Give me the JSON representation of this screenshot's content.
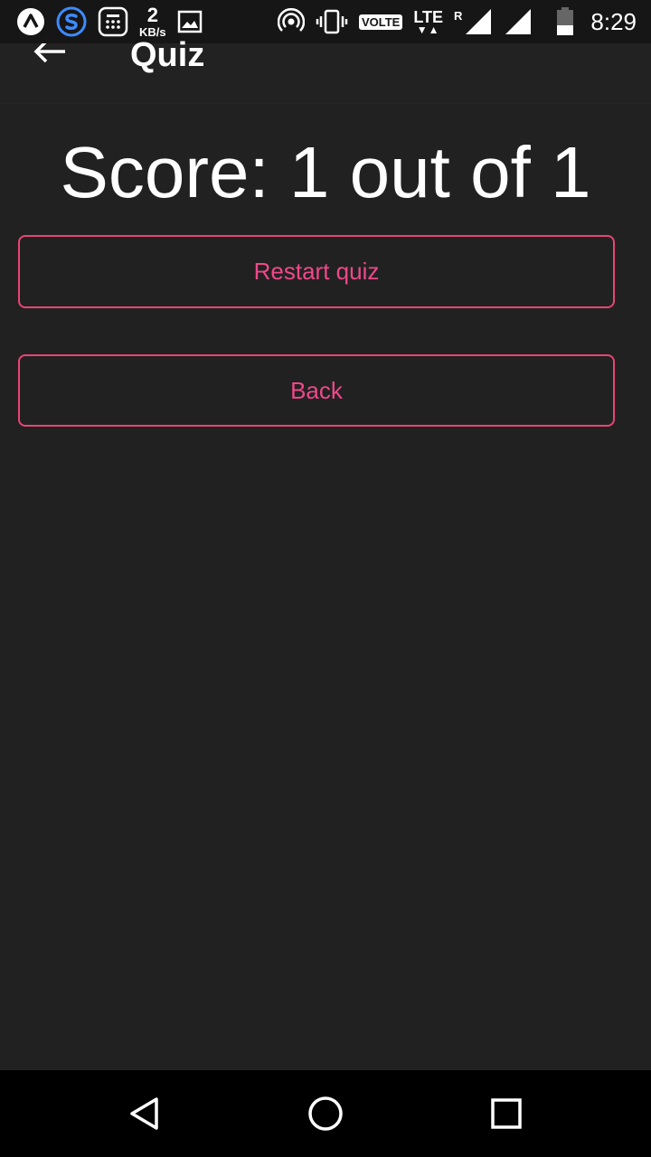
{
  "status_bar": {
    "icons_left": [
      "app-a-icon",
      "s-app-icon",
      "calculator-icon",
      "image-icon"
    ],
    "net_speed_value": "2",
    "net_speed_unit": "KB/s",
    "icons_right": [
      "hotspot-icon",
      "vibrate-icon",
      "signal-icon",
      "signal-icon",
      "battery-icon"
    ],
    "volte": "VOLTE",
    "lte": "LTE",
    "roaming": "R",
    "time": "8:29"
  },
  "app_bar": {
    "title": "Quiz",
    "back_icon": "arrow-left-icon"
  },
  "main": {
    "score_text": "Score: 1 out of 1",
    "restart_label": "Restart quiz",
    "back_label": "Back"
  },
  "nav_bar": {
    "icons": [
      "back-triangle-icon",
      "home-circle-icon",
      "recents-square-icon"
    ]
  },
  "colors": {
    "background": "#212121",
    "accent": "#e94477",
    "text": "#ffffff",
    "status_bar": "#161616",
    "nav_bar": "#000000"
  }
}
